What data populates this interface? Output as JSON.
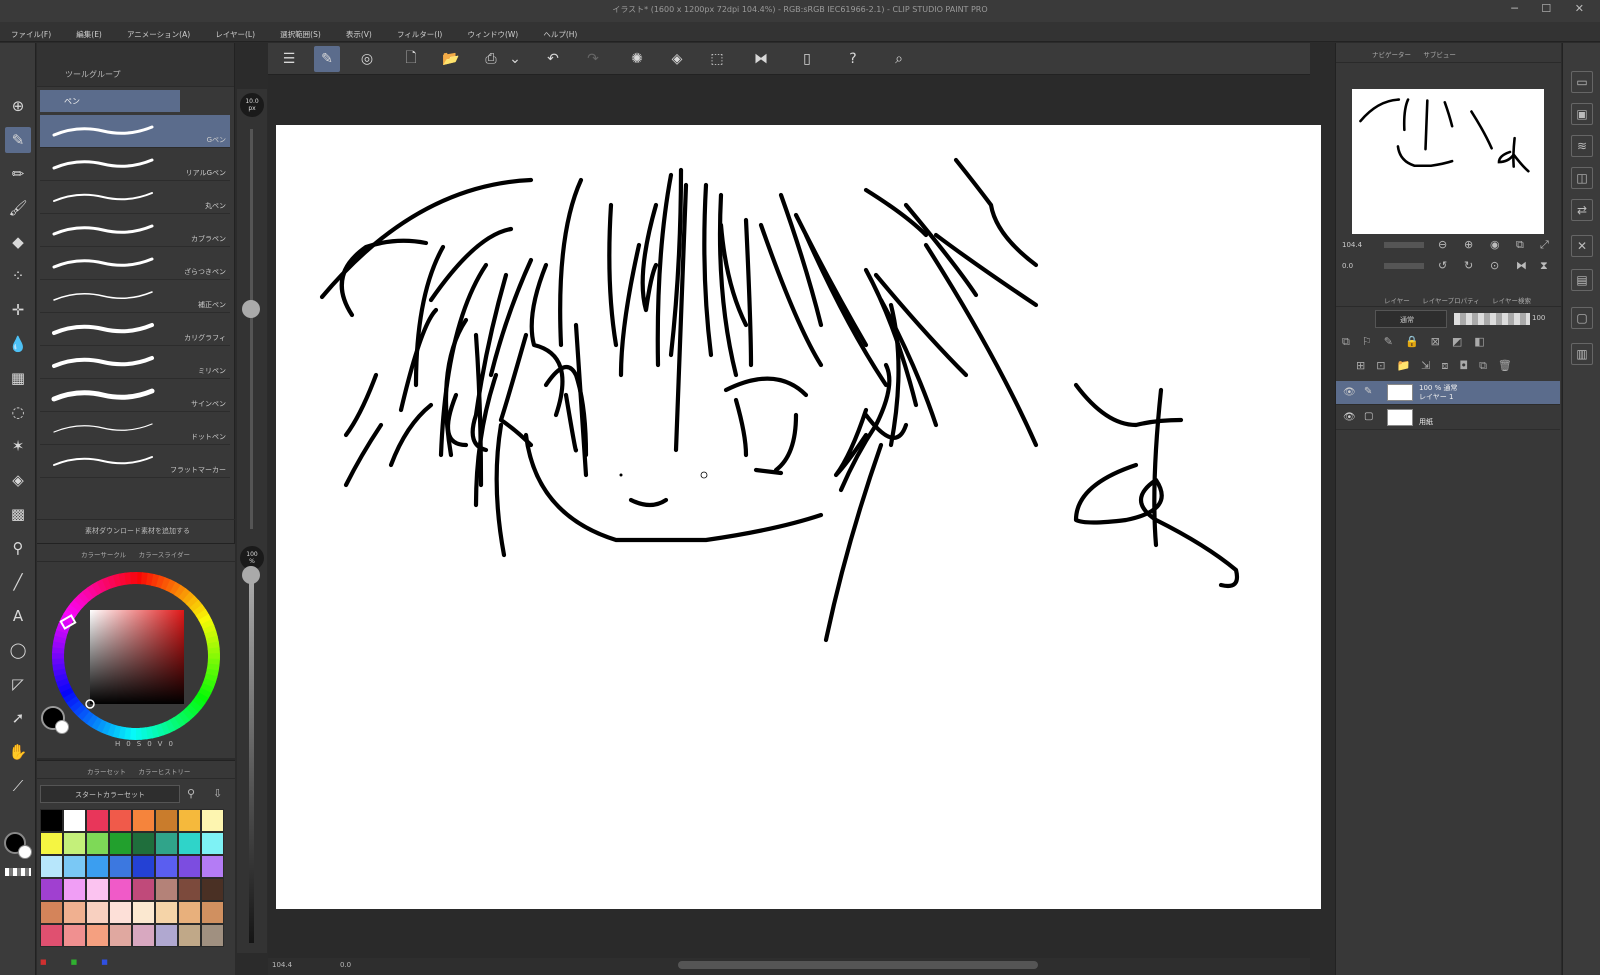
{
  "window": {
    "title": "イラスト* (1600 x 1200px 72dpi 104.4%) - RGB:sRGB IEC61966-2.1) - CLIP STUDIO PAINT PRO",
    "controls": [
      "─",
      "☐",
      "✕"
    ]
  },
  "menu": [
    "ファイル(F)",
    "編集(E)",
    "アニメーション(A)",
    "レイヤー(L)",
    "選択範囲(S)",
    "表示(V)",
    "フィルター(I)",
    "ウィンドウ(W)",
    "ヘルプ(H)"
  ],
  "subtool": {
    "panel_tabs": [
      "ツールグループ"
    ],
    "group_label": "ペン",
    "brushes": [
      {
        "name": "Gペン",
        "selected": true
      },
      {
        "name": "リアルGペン",
        "selected": false
      },
      {
        "name": "丸ペン",
        "selected": false
      },
      {
        "name": "カブラペン",
        "selected": false
      },
      {
        "name": "ざらつきペン",
        "selected": false
      },
      {
        "name": "補正ペン",
        "selected": false
      },
      {
        "name": "カリグラフィ",
        "selected": false
      },
      {
        "name": "ミリペン",
        "selected": false
      },
      {
        "name": "サインペン",
        "selected": false
      },
      {
        "name": "ドットペン",
        "selected": false
      },
      {
        "name": "フラットマーカー",
        "selected": false
      }
    ],
    "footer_text": "素材ダウンロード素材を追加する"
  },
  "brush_size": {
    "value": "10.0",
    "unit": "px",
    "level": 0.55
  },
  "color_panel": {
    "tabs": [
      "カラーサークル",
      "カラースライダー"
    ],
    "hsv_labels": [
      "H",
      "0",
      "S",
      "0",
      "V",
      "0"
    ],
    "main_color": "#000000",
    "sub_color": "#ffffff"
  },
  "opacity": {
    "value": "100",
    "unit": "%"
  },
  "color_set": {
    "tabs": [
      "カラーセット",
      "カラーヒストリー"
    ],
    "set_name": "スタートカラーセット",
    "swatches": [
      "#000000",
      "#ffffff",
      "#e8365a",
      "#f05a4a",
      "#f5843c",
      "#c97c2c",
      "#f5b93c",
      "#fdf5b0",
      "#f5f542",
      "#c4f07a",
      "#7ed957",
      "#22a02d",
      "#1f6e3c",
      "#30a48a",
      "#2fd4c9",
      "#7ef2f5",
      "#b7e6fb",
      "#7ac8f5",
      "#3b9ef0",
      "#3c78e0",
      "#2441d4",
      "#5a5ef0",
      "#7c4de0",
      "#b47cf5",
      "#a040d0",
      "#f09ef5",
      "#fbc3f0",
      "#f05ac8",
      "#c04a7a",
      "#b48278",
      "#7c4a3c",
      "#4a3024",
      "#d4845a",
      "#f0b090",
      "#f8d0c0",
      "#fde0d8",
      "#fbe8d0",
      "#f5d4a8",
      "#e8b07c",
      "#d09060",
      "#e05070",
      "#f09090",
      "#f5a080",
      "#e0a8a0",
      "#d8a8c0",
      "#b0a8d0",
      "#c0a888",
      "#a09080"
    ],
    "rgb_labels": [
      "■",
      "■",
      "■"
    ]
  },
  "status": {
    "zoom": "104.4",
    "angle": "0.0"
  },
  "navigator": {
    "tabs": [
      "ナビゲーター",
      "サブビュー"
    ],
    "zoom": "104.4",
    "rotate": "0.0"
  },
  "layer_panel": {
    "tabs": [
      "レイヤー",
      "レイヤープロパティ",
      "レイヤー検索"
    ],
    "blend_mode": "通常",
    "opacity": "100",
    "layers": [
      {
        "line1": "100 % 通常",
        "line2": "レイヤー 1",
        "selected": true
      },
      {
        "line1": "",
        "line2": "用紙",
        "selected": false
      }
    ]
  },
  "canvas": {
    "background": "#ffffff",
    "stroke_color": "#000000"
  }
}
